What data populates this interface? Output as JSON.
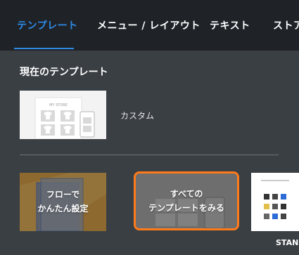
{
  "tabs": [
    {
      "label": "テンプレート",
      "active": true
    },
    {
      "label": "メニュー / レイアウト",
      "active": false
    },
    {
      "label": "テキスト",
      "active": false
    },
    {
      "label": "ストア",
      "active": false
    }
  ],
  "section_title": "現在のテンプレート",
  "current_template": {
    "thumbnail_text": "MY STORE",
    "label": "カスタム"
  },
  "cards": {
    "flow": {
      "line1": "フローで",
      "line2": "かんたん設定"
    },
    "all": {
      "line1": "すべての",
      "line2": "テンプレートをみる"
    }
  },
  "bottom_label": "STAN",
  "colors": {
    "accent": "#2e8ae6",
    "highlight": "#ff7a1a",
    "topbar": "#1f2328",
    "panel": "#3a3f44"
  }
}
